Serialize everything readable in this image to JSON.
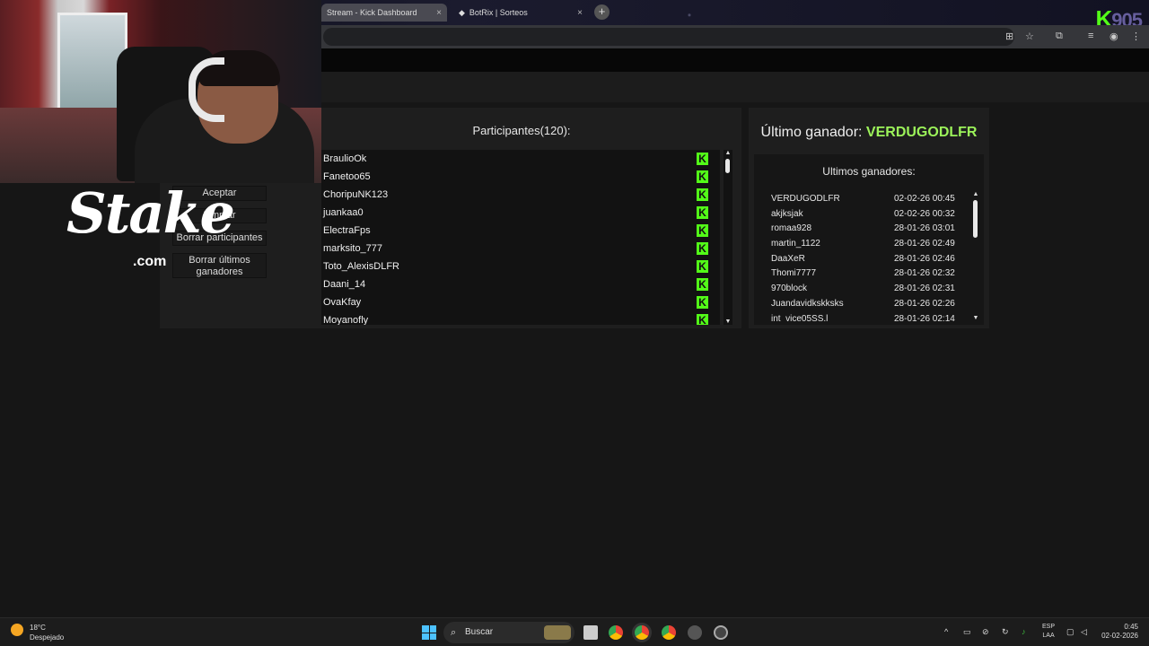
{
  "browser": {
    "tabs": [
      {
        "label": "Stream - Kick Dashboard",
        "close": "×"
      },
      {
        "label": "BotRix | Sorteos",
        "close": "×"
      }
    ],
    "new_tab": "+",
    "icons": [
      "translate-icon",
      "star-icon",
      "extensions-icon",
      "media-icon",
      "profile-icon",
      "menu-icon"
    ]
  },
  "watermark": {
    "k": "K",
    "text": "905"
  },
  "left_panel": {
    "buttons": [
      "Aceptar",
      "Limpiar",
      "Borrar participantes",
      "Borrar últimos ganadores"
    ]
  },
  "participants": {
    "title": "Participantes(120):",
    "badge": "K",
    "items": [
      "BraulioOk",
      "Fanetoo65",
      "ChoripuNK123",
      "juankaa0",
      "ElectraFps",
      "marksito_777",
      "Toto_AlexisDLFR",
      "Daani_14",
      "OvaKfay",
      "Moyanofly"
    ]
  },
  "winners": {
    "last_label": "Último ganador:",
    "last_name": "VERDUGODLFR",
    "list_title": "Ultimos ganadores:",
    "items": [
      {
        "name": "VERDUGODLFR",
        "date": "02-02-26 00:45"
      },
      {
        "name": "akjksjak",
        "date": "02-02-26 00:32"
      },
      {
        "name": "romaa928",
        "date": "28-01-26 03:01"
      },
      {
        "name": "martin_1122",
        "date": "28-01-26 02:49"
      },
      {
        "name": "DaaXeR",
        "date": "28-01-26 02:46"
      },
      {
        "name": "Thomi7777",
        "date": "28-01-26 02:32"
      },
      {
        "name": "970block",
        "date": "28-01-26 02:31"
      },
      {
        "name": "Juandavidkskksks",
        "date": "28-01-26 02:26"
      },
      {
        "name": "int_vice05SS.l",
        "date": "28-01-26 02:14"
      }
    ]
  },
  "overlay": {
    "stake": "Stake",
    "stake_com": ".com"
  },
  "taskbar": {
    "temp": "18°C",
    "weather": "Despejado",
    "search": "Buscar",
    "lang1": "ESP",
    "lang2": "LAA",
    "time": "0:45",
    "date": "02-02-2026"
  },
  "colors": {
    "kick_green": "#53fc18",
    "winner_green": "#9cf35a",
    "panel": "#1e1e1e"
  }
}
